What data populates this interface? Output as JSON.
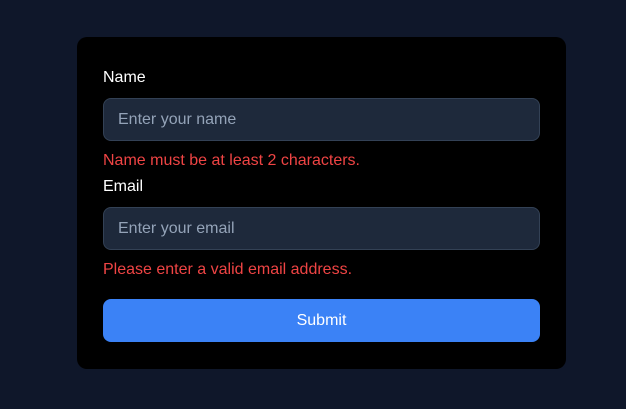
{
  "form": {
    "name_field": {
      "label": "Name",
      "placeholder": "Enter your name",
      "value": "",
      "error": "Name must be at least 2 characters."
    },
    "email_field": {
      "label": "Email",
      "placeholder": "Enter your email",
      "value": "",
      "error": "Please enter a valid email address."
    },
    "submit_label": "Submit"
  },
  "colors": {
    "page_background": "#0f172a",
    "card_background": "#000000",
    "input_background": "#1e293b",
    "error": "#ef4444",
    "accent": "#3b82f6"
  }
}
